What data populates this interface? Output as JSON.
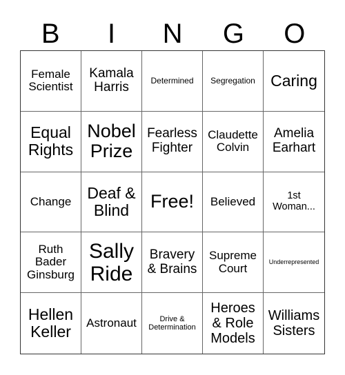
{
  "header": {
    "letters": [
      "B",
      "I",
      "N",
      "G",
      "O"
    ]
  },
  "cells": [
    "Female Scientist",
    "Kamala Harris",
    "Determined",
    "Segregation",
    "Caring",
    "Equal Rights",
    "Nobel Prize",
    "Fearless Fighter",
    "Claudette Colvin",
    "Amelia Earhart",
    "Change",
    "Deaf & Blind",
    "Free!",
    "Believed",
    "1st Woman...",
    "Ruth Bader Ginsburg",
    "Sally Ride",
    "Bravery & Brains",
    "Supreme Court",
    "Underrepresented",
    "Hellen Keller",
    "Astronaut",
    "Drive & Determination",
    "Heroes & Role Models",
    "Williams Sisters"
  ]
}
